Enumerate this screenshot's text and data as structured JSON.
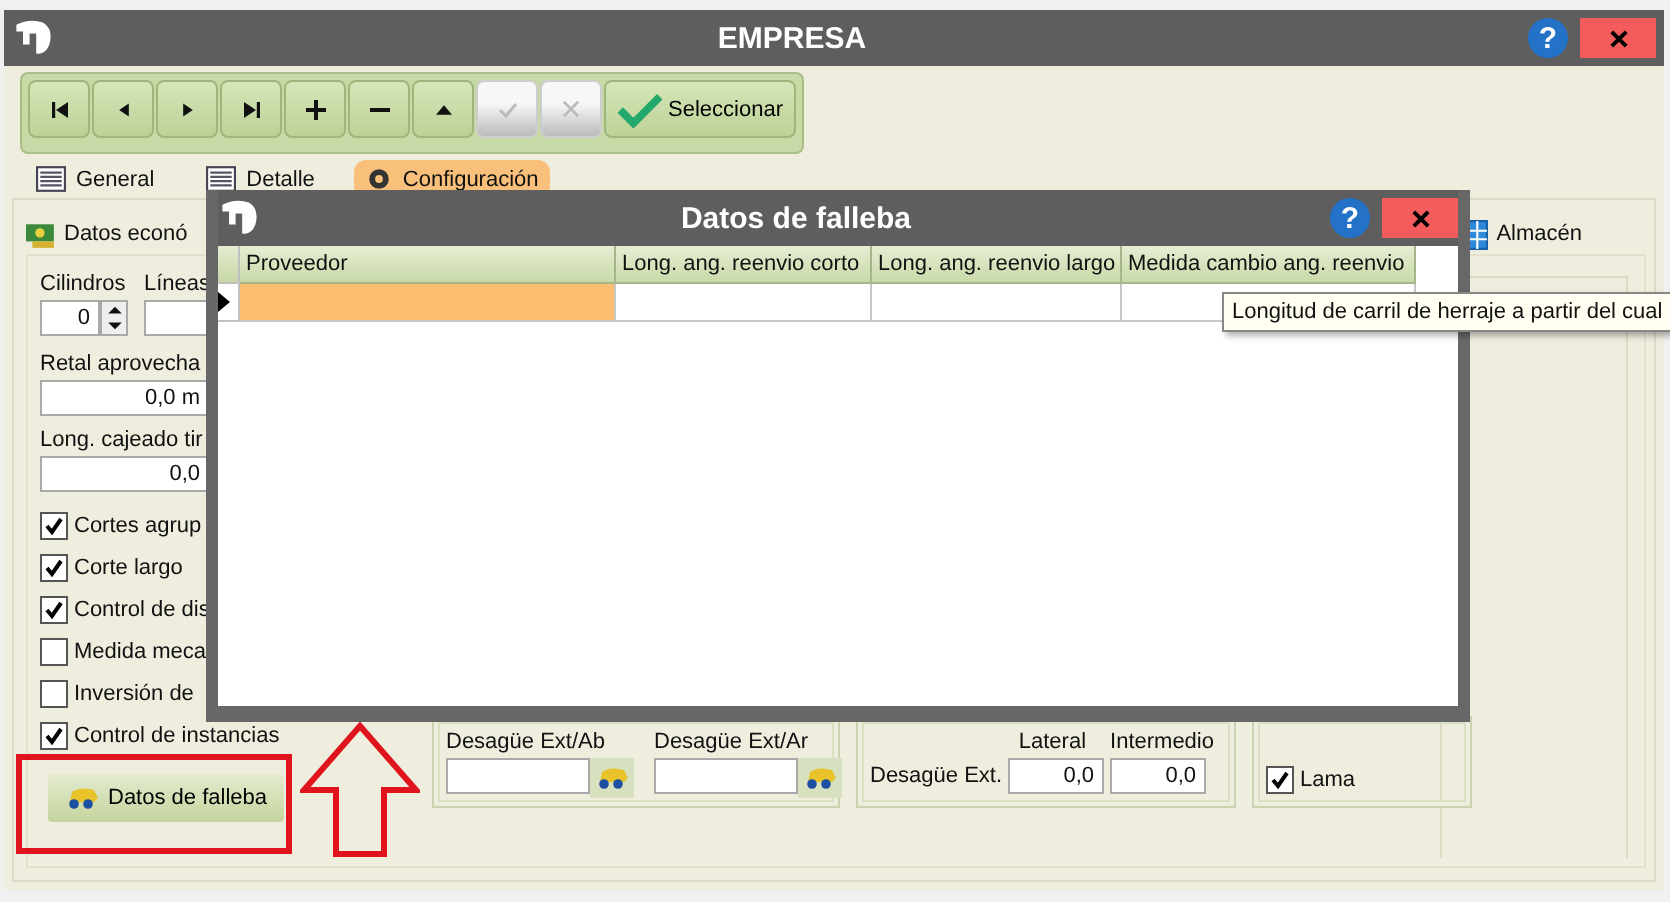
{
  "window": {
    "title": "EMPRESA",
    "help": "?"
  },
  "toolbar": {
    "buttons": [
      {
        "kind": "first",
        "disabled": false
      },
      {
        "kind": "prev",
        "disabled": false
      },
      {
        "kind": "next",
        "disabled": false
      },
      {
        "kind": "last",
        "disabled": false
      },
      {
        "kind": "add",
        "disabled": false
      },
      {
        "kind": "remove",
        "disabled": false
      },
      {
        "kind": "up",
        "disabled": false
      },
      {
        "kind": "accept",
        "disabled": true
      },
      {
        "kind": "cancel",
        "disabled": true
      },
      {
        "kind": "select",
        "label": "Seleccionar",
        "disabled": false
      }
    ]
  },
  "tabs": [
    {
      "label": "General",
      "selected": false
    },
    {
      "label": "Detalle",
      "selected": false
    },
    {
      "label": "Configuración",
      "selected": true
    }
  ],
  "left_tab": {
    "label": "Datos econó"
  },
  "right_tab": {
    "label": "Almacén"
  },
  "cilindros": {
    "label": "Cilindros",
    "value": "0"
  },
  "lineas": {
    "label": "Líneas"
  },
  "retal": {
    "label": "Retal aprovecha",
    "value": "0,0 m"
  },
  "cajeado": {
    "label": "Long. cajeado tir",
    "value": "0,0"
  },
  "checkboxes": [
    {
      "label": "Cortes agrup",
      "checked": true
    },
    {
      "label": "Corte largo",
      "checked": true
    },
    {
      "label": "Control de dis",
      "checked": true
    },
    {
      "label": "Medida meca",
      "checked": false
    },
    {
      "label": "Inversión de",
      "checked": false
    },
    {
      "label": "Control de instancias",
      "checked": true
    }
  ],
  "falleba_button": {
    "label": "Datos de falleba"
  },
  "desague_fields": [
    {
      "label": "Desagüe Ext/Ab"
    },
    {
      "label": "Desagüe Ext/Ar"
    }
  ],
  "desague_ext": {
    "label": "Desagüe Ext.",
    "column_labels": [
      "Lateral",
      "Intermedio"
    ],
    "values": [
      "0,0",
      "0,0"
    ]
  },
  "lama": {
    "label": "Lama",
    "checked": true
  },
  "dialog": {
    "title": "Datos de falleba",
    "help": "?",
    "columns": [
      "Proveedor",
      "Long. ang. reenvio corto",
      "Long. ang. reenvio largo",
      "Medida cambio ang. reenvio"
    ],
    "rows": [
      {
        "selected": true
      }
    ]
  },
  "tooltip": {
    "text": "Longitud de carril de herraje a partir del cual"
  },
  "annotations": {
    "highlight_box": true,
    "arrow": true
  }
}
